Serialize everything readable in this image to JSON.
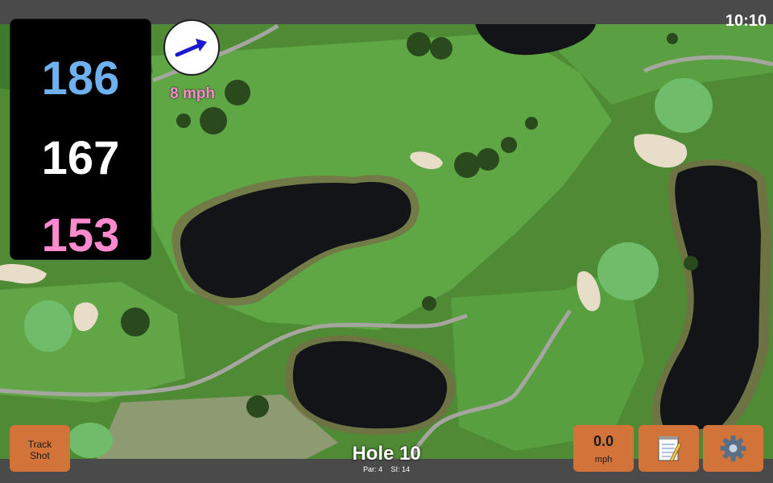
{
  "status_bar": {
    "time": "10:10"
  },
  "distances": {
    "back": "186",
    "middle": "167",
    "front": "153"
  },
  "wind": {
    "speed_label": "8 mph",
    "direction_icon": "arrow-icon",
    "arrow_color": "#1a1acc"
  },
  "hole": {
    "title": "Hole 10",
    "par_label": "Par: 4",
    "si_label": "SI: 14"
  },
  "buttons": {
    "track_shot_line1": "Track",
    "track_shot_line2": "Shot",
    "speed_value": "0.0",
    "speed_unit": "mph",
    "notes_icon": "notepad-icon",
    "settings_icon": "gear-icon"
  },
  "colors": {
    "button": "#d2733a",
    "back_distance": "#6fb1f0",
    "middle_distance": "#ffffff",
    "front_distance": "#ff8ad0",
    "fairway": "#5a9e3e",
    "rough": "#4f8a35",
    "water": "#121418",
    "bunker": "#e8ddc8"
  }
}
